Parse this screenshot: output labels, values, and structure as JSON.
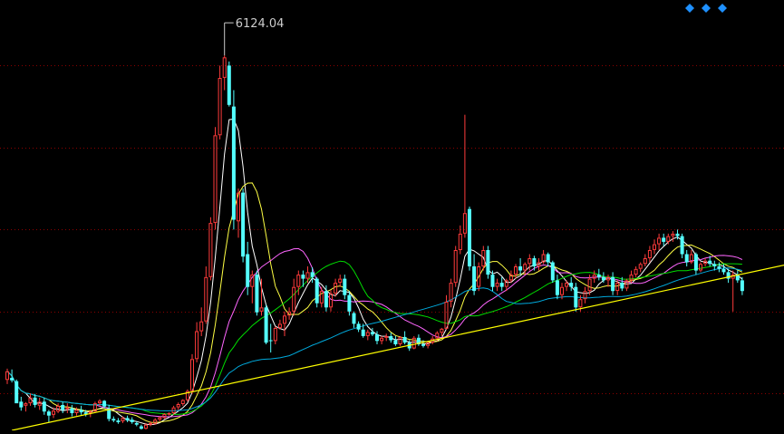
{
  "chart_data": {
    "type": "candlestick",
    "title": "",
    "ylim": [
      1550,
      6800
    ],
    "gridlines": [
      6000,
      5000,
      4000,
      3000,
      2000
    ],
    "grid": true,
    "annotation_high": "6124.04",
    "colors": {
      "background": "#000000",
      "up": "#ff3b3b",
      "down": "#54ffff",
      "grid": "#8b0000",
      "ma1": "#ffffff",
      "ma2": "#ffff44",
      "ma3": "#ff66ff",
      "ma4": "#00dd00",
      "ma5": "#00aadd",
      "trendline": "#ffff00",
      "nav": "#1e90ff"
    },
    "trendline": {
      "start": [
        1,
        1550
      ],
      "end": [
        175,
        3650
      ]
    },
    "candles": [
      [
        2166,
        2303,
        2115,
        2271
      ],
      [
        2190,
        2293,
        2135,
        2160
      ],
      [
        2150,
        2170,
        1980,
        1880
      ],
      [
        1900,
        1960,
        1790,
        1830
      ],
      [
        1850,
        1895,
        1780,
        1880
      ],
      [
        1880,
        2000,
        1850,
        1950
      ],
      [
        1950,
        1995,
        1830,
        1860
      ],
      [
        1850,
        1950,
        1800,
        1900
      ],
      [
        1900,
        1950,
        1740,
        1780
      ],
      [
        1780,
        1800,
        1650,
        1730
      ],
      [
        1740,
        1830,
        1700,
        1790
      ],
      [
        1780,
        1880,
        1760,
        1850
      ],
      [
        1860,
        1900,
        1760,
        1800
      ],
      [
        1810,
        1880,
        1760,
        1830
      ],
      [
        1820,
        1860,
        1720,
        1760
      ],
      [
        1760,
        1830,
        1730,
        1800
      ],
      [
        1800,
        1850,
        1740,
        1770
      ],
      [
        1770,
        1800,
        1720,
        1750
      ],
      [
        1760,
        1800,
        1710,
        1780
      ],
      [
        1780,
        1900,
        1770,
        1880
      ],
      [
        1880,
        1930,
        1850,
        1910
      ],
      [
        1910,
        1920,
        1820,
        1840
      ],
      [
        1820,
        1860,
        1660,
        1690
      ],
      [
        1690,
        1720,
        1650,
        1670
      ],
      [
        1670,
        1700,
        1630,
        1650
      ],
      [
        1660,
        1720,
        1640,
        1700
      ],
      [
        1700,
        1730,
        1650,
        1670
      ],
      [
        1680,
        1710,
        1630,
        1650
      ],
      [
        1640,
        1660,
        1600,
        1620
      ],
      [
        1600,
        1620,
        1560,
        1570
      ],
      [
        1570,
        1640,
        1560,
        1620
      ],
      [
        1620,
        1660,
        1600,
        1640
      ],
      [
        1630,
        1700,
        1620,
        1680
      ],
      [
        1680,
        1720,
        1660,
        1710
      ],
      [
        1700,
        1760,
        1690,
        1750
      ],
      [
        1750,
        1770,
        1730,
        1760
      ],
      [
        1760,
        1850,
        1740,
        1830
      ],
      [
        1830,
        1890,
        1800,
        1870
      ],
      [
        1870,
        1930,
        1850,
        1920
      ],
      [
        1920,
        2050,
        1900,
        2030
      ],
      [
        2030,
        2480,
        2000,
        2420
      ],
      [
        2420,
        2870,
        2380,
        2760
      ],
      [
        2760,
        3050,
        2700,
        2880
      ],
      [
        2880,
        3550,
        2850,
        3420
      ],
      [
        3420,
        4150,
        3380,
        4080
      ],
      [
        4080,
        5250,
        4000,
        5150
      ],
      [
        5150,
        6000,
        5100,
        5850
      ],
      [
        5850,
        6124,
        5700,
        6100
      ],
      [
        6000,
        6050,
        5500,
        5520
      ],
      [
        5500,
        5700,
        4000,
        4120
      ],
      [
        4100,
        4500,
        3900,
        4450
      ],
      [
        4450,
        4500,
        3600,
        3670
      ],
      [
        3700,
        3850,
        3200,
        3300
      ],
      [
        3300,
        3500,
        3100,
        3450
      ],
      [
        3450,
        3500,
        2950,
        2990
      ],
      [
        3000,
        3400,
        2950,
        3050
      ],
      [
        3050,
        3080,
        2600,
        2620
      ],
      [
        2650,
        2850,
        2500,
        2640
      ],
      [
        2640,
        2820,
        2600,
        2800
      ],
      [
        2800,
        2900,
        2780,
        2850
      ],
      [
        2850,
        3000,
        2700,
        2950
      ],
      [
        2950,
        3050,
        2900,
        3000
      ],
      [
        3000,
        3400,
        2950,
        3300
      ],
      [
        3300,
        3500,
        3200,
        3450
      ],
      [
        3450,
        3500,
        3300,
        3400
      ],
      [
        3400,
        3550,
        3350,
        3480
      ],
      [
        3480,
        3540,
        3350,
        3420
      ],
      [
        3400,
        3420,
        3050,
        3100
      ],
      [
        3100,
        3300,
        3050,
        3250
      ],
      [
        3250,
        3320,
        3000,
        3050
      ],
      [
        3050,
        3260,
        3000,
        3220
      ],
      [
        3220,
        3400,
        3180,
        3350
      ],
      [
        3350,
        3450,
        3300,
        3400
      ],
      [
        3400,
        3450,
        3150,
        3200
      ],
      [
        3200,
        3250,
        2950,
        3000
      ],
      [
        2980,
        3000,
        2800,
        2850
      ],
      [
        2850,
        2880,
        2750,
        2780
      ],
      [
        2780,
        2850,
        2680,
        2700
      ],
      [
        2700,
        2780,
        2650,
        2750
      ],
      [
        2750,
        2800,
        2700,
        2720
      ],
      [
        2720,
        2760,
        2600,
        2640
      ],
      [
        2640,
        2700,
        2600,
        2680
      ],
      [
        2680,
        2730,
        2640,
        2700
      ],
      [
        2700,
        2740,
        2620,
        2650
      ],
      [
        2650,
        2700,
        2580,
        2600
      ],
      [
        2600,
        2700,
        2580,
        2690
      ],
      [
        2690,
        2760,
        2600,
        2620
      ],
      [
        2620,
        2650,
        2520,
        2550
      ],
      [
        2550,
        2700,
        2540,
        2680
      ],
      [
        2680,
        2720,
        2580,
        2600
      ],
      [
        2600,
        2650,
        2560,
        2580
      ],
      [
        2580,
        2640,
        2550,
        2620
      ],
      [
        2620,
        2700,
        2600,
        2670
      ],
      [
        2670,
        2760,
        2640,
        2740
      ],
      [
        2740,
        2800,
        2700,
        2790
      ],
      [
        2790,
        3200,
        2780,
        3120
      ],
      [
        3120,
        3400,
        3050,
        3350
      ],
      [
        3350,
        3800,
        3300,
        3750
      ],
      [
        3750,
        4050,
        3700,
        3950
      ],
      [
        3950,
        5400,
        3900,
        4200
      ],
      [
        4250,
        4280,
        3500,
        3550
      ],
      [
        3550,
        3700,
        3200,
        3250
      ],
      [
        3300,
        3600,
        3250,
        3550
      ],
      [
        3550,
        3800,
        3500,
        3750
      ],
      [
        3750,
        3800,
        3400,
        3450
      ],
      [
        3450,
        3500,
        3250,
        3300
      ],
      [
        3300,
        3400,
        3250,
        3350
      ],
      [
        3350,
        3420,
        3250,
        3300
      ],
      [
        3300,
        3400,
        3250,
        3380
      ],
      [
        3380,
        3500,
        3350,
        3450
      ],
      [
        3450,
        3580,
        3400,
        3550
      ],
      [
        3550,
        3650,
        3450,
        3500
      ],
      [
        3500,
        3600,
        3450,
        3580
      ],
      [
        3580,
        3700,
        3500,
        3650
      ],
      [
        3650,
        3680,
        3500,
        3550
      ],
      [
        3550,
        3650,
        3500,
        3600
      ],
      [
        3600,
        3750,
        3580,
        3700
      ],
      [
        3700,
        3720,
        3550,
        3600
      ],
      [
        3600,
        3620,
        3350,
        3380
      ],
      [
        3380,
        3450,
        3150,
        3200
      ],
      [
        3200,
        3350,
        3150,
        3300
      ],
      [
        3300,
        3380,
        3250,
        3350
      ],
      [
        3350,
        3420,
        3250,
        3300
      ],
      [
        3300,
        3350,
        3000,
        3050
      ],
      [
        3050,
        3200,
        3000,
        3150
      ],
      [
        3150,
        3300,
        3100,
        3250
      ],
      [
        3250,
        3450,
        3200,
        3400
      ],
      [
        3400,
        3500,
        3350,
        3450
      ],
      [
        3450,
        3520,
        3380,
        3420
      ],
      [
        3420,
        3480,
        3350,
        3380
      ],
      [
        3380,
        3450,
        3300,
        3420
      ],
      [
        3420,
        3480,
        3200,
        3250
      ],
      [
        3250,
        3380,
        3200,
        3350
      ],
      [
        3350,
        3420,
        3250,
        3280
      ],
      [
        3280,
        3400,
        3250,
        3380
      ],
      [
        3380,
        3500,
        3350,
        3450
      ],
      [
        3450,
        3550,
        3420,
        3520
      ],
      [
        3520,
        3600,
        3480,
        3580
      ],
      [
        3580,
        3700,
        3550,
        3650
      ],
      [
        3650,
        3800,
        3600,
        3750
      ],
      [
        3750,
        3880,
        3700,
        3820
      ],
      [
        3820,
        3950,
        3750,
        3900
      ],
      [
        3900,
        3950,
        3800,
        3850
      ],
      [
        3850,
        3950,
        3820,
        3920
      ],
      [
        3920,
        3980,
        3850,
        3950
      ],
      [
        3950,
        4000,
        3880,
        3920
      ],
      [
        3920,
        3950,
        3650,
        3700
      ],
      [
        3700,
        3750,
        3550,
        3600
      ],
      [
        3600,
        3750,
        3580,
        3700
      ],
      [
        3700,
        3720,
        3450,
        3500
      ],
      [
        3500,
        3600,
        3480,
        3580
      ],
      [
        3580,
        3650,
        3550,
        3620
      ],
      [
        3620,
        3680,
        3550,
        3580
      ],
      [
        3580,
        3620,
        3500,
        3550
      ],
      [
        3550,
        3600,
        3480,
        3520
      ],
      [
        3520,
        3580,
        3450,
        3480
      ],
      [
        3480,
        3520,
        3350,
        3400
      ],
      [
        3400,
        3500,
        3000,
        3450
      ],
      [
        3450,
        3500,
        3350,
        3380
      ],
      [
        3380,
        3420,
        3200,
        3250
      ]
    ]
  }
}
